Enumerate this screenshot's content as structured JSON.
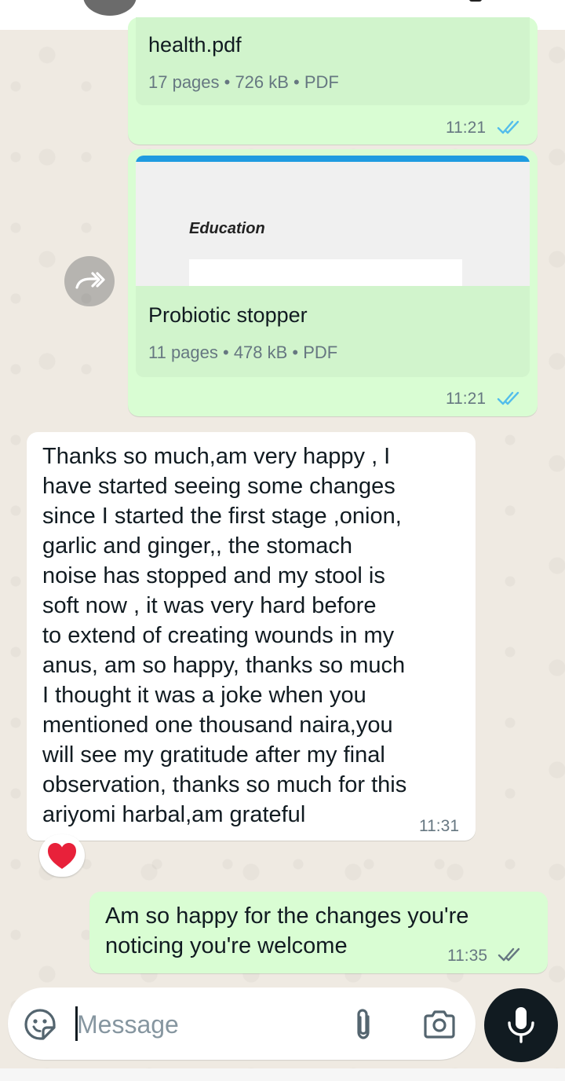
{
  "messages": {
    "doc1": {
      "file_name": "health.pdf",
      "meta": "17 pages • 726 kB • PDF",
      "time": "11:21",
      "status": "read"
    },
    "doc2": {
      "preview_heading": "Education",
      "file_name": "Probiotic stopper",
      "meta": "11 pages • 478 kB • PDF",
      "time": "11:21",
      "status": "read"
    },
    "incoming": {
      "text": "Thanks so much,am very happy , I\nhave started seeing some changes\nsince I started the first stage ,onion,\ngarlic and ginger,, the stomach\nnoise has stopped and my stool is\nsoft now , it was very hard before\nto extend of creating wounds in my\nanus, am so happy, thanks so much\nI thought it was a joke when you\nmentioned one thousand naira,you\nwill see my gratitude after my final\nobservation, thanks so much for this\nariyomi harbal,am grateful",
      "time": "11:31",
      "reaction": "❤️"
    },
    "outgoing": {
      "text": "Am so happy for the changes you're\nnoticing you're welcome",
      "time": "11:35",
      "status": "delivered"
    }
  },
  "composer": {
    "placeholder": "Message"
  },
  "icons": {
    "emoji": "sticker-smiley-icon",
    "attach": "paperclip-icon",
    "camera": "camera-icon",
    "mic": "microphone-icon",
    "forward": "forward-icon",
    "read_ticks": "double-check-icon"
  },
  "colors": {
    "outgoing_bubble": "#d9fdd3",
    "incoming_bubble": "#ffffff",
    "read_ticks": "#53bdeb",
    "delivered_ticks": "#667781",
    "wallpaper": "#efeae2"
  }
}
